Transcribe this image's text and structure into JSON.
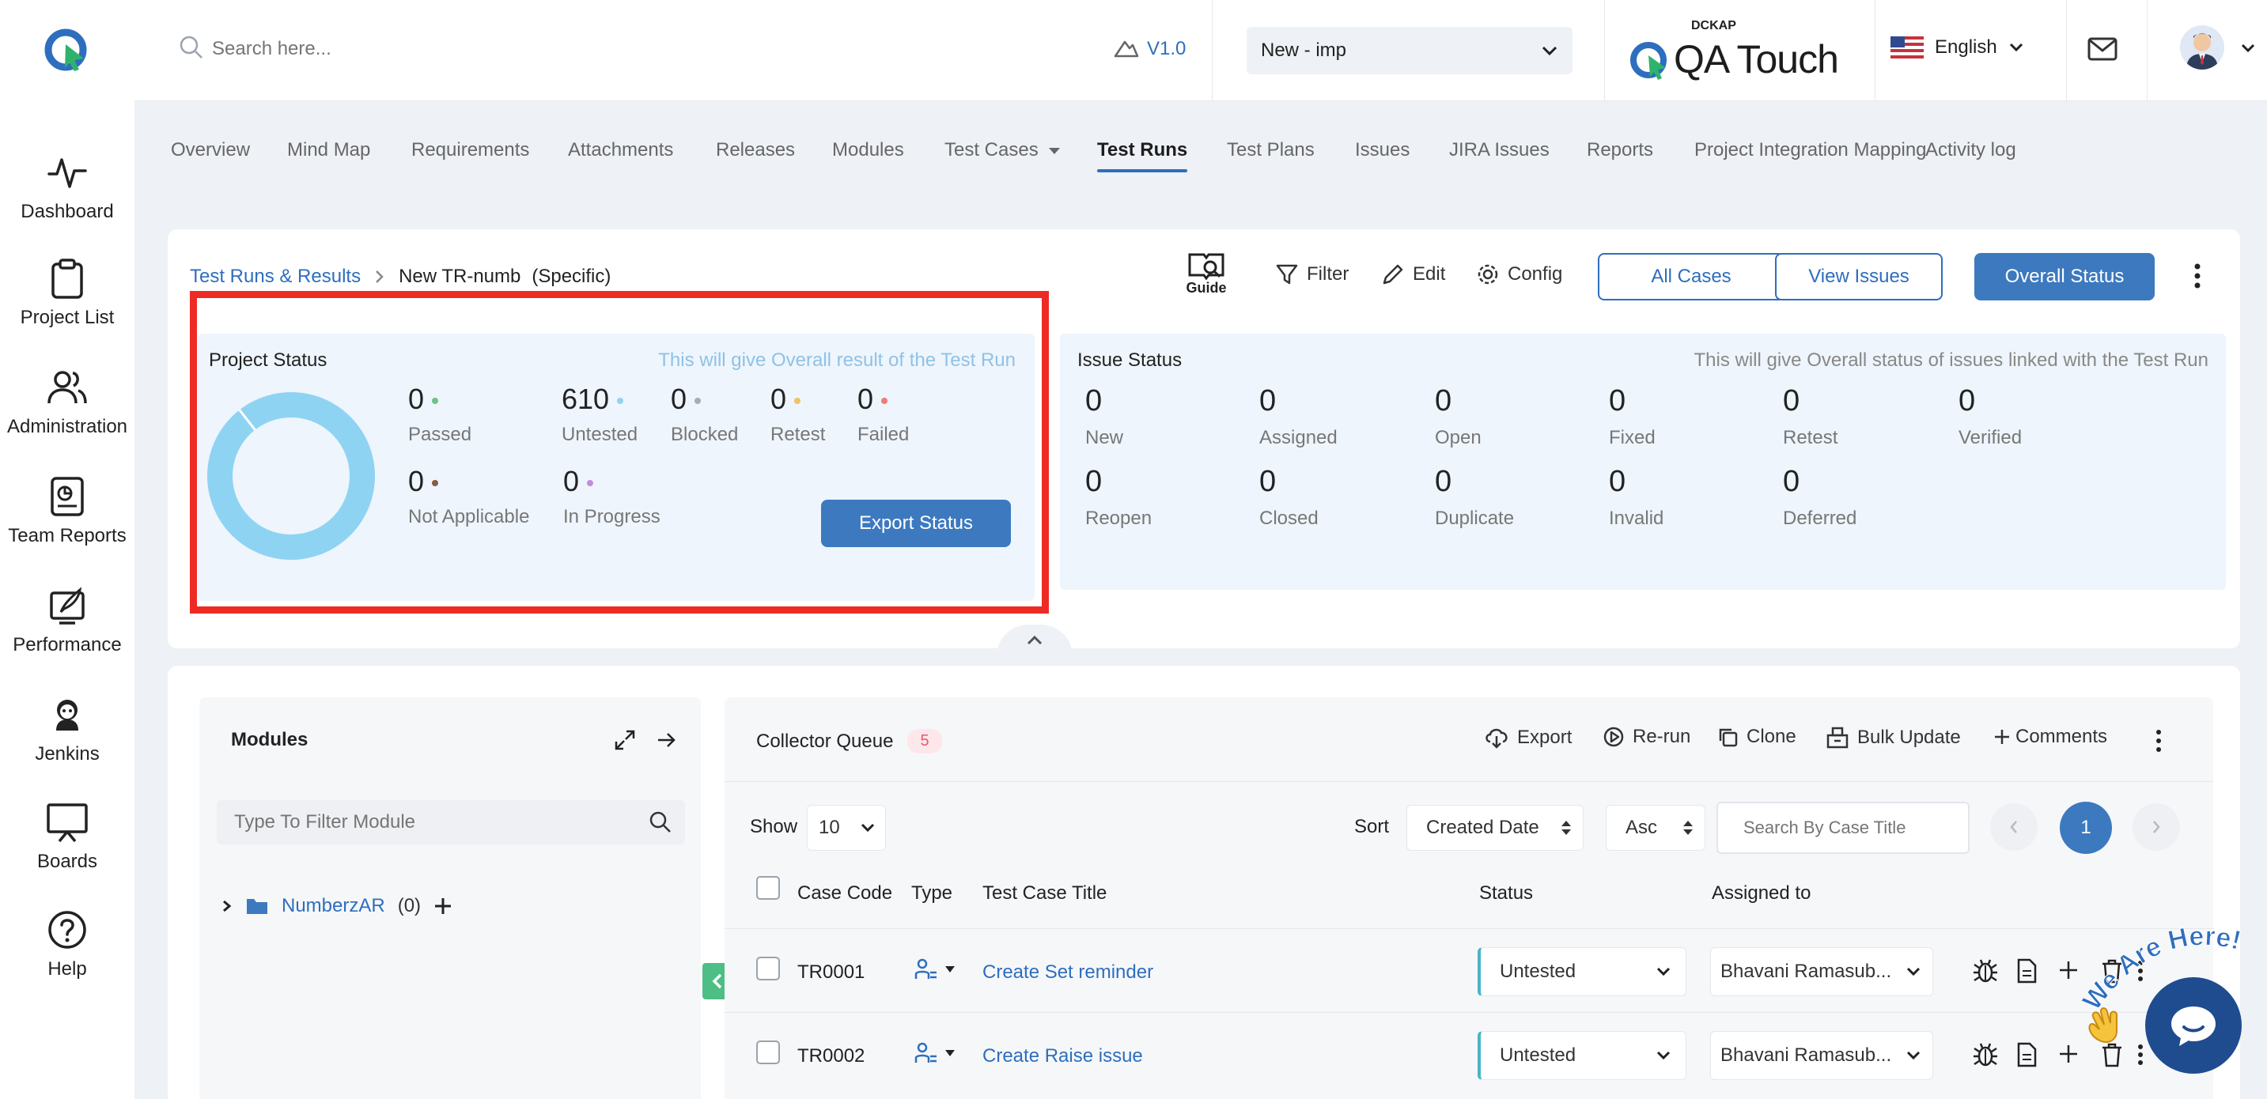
{
  "sidebar": {
    "items": [
      {
        "label": "Dashboard",
        "icon": "pulse-icon"
      },
      {
        "label": "Project List",
        "icon": "clipboard-icon"
      },
      {
        "label": "Administration",
        "icon": "users-icon"
      },
      {
        "label": "Team Reports",
        "icon": "report-icon"
      },
      {
        "label": "Performance",
        "icon": "rocket-icon"
      },
      {
        "label": "Jenkins",
        "icon": "jenkins-icon"
      },
      {
        "label": "Boards",
        "icon": "presentation-board-icon"
      },
      {
        "label": "Help",
        "icon": "question-circle-icon"
      }
    ]
  },
  "topbar": {
    "search_placeholder": "Search here...",
    "version": "V1.0",
    "project_select": "New - imp",
    "brand_small": "DCKAP",
    "brand_large": "QA Touch",
    "language": "English"
  },
  "tabs": [
    "Overview",
    "Mind Map",
    "Requirements",
    "Attachments",
    "Releases",
    "Modules",
    "Test Cases",
    "Test Runs",
    "Test Plans",
    "Issues",
    "JIRA Issues",
    "Reports",
    "Project Integration Mapping",
    "Activity log"
  ],
  "active_tab": "Test Runs",
  "breadcrumb": {
    "parent": "Test Runs & Results",
    "current": "New TR-numb",
    "qualifier": "(Specific)"
  },
  "toolbar": {
    "guide": "Guide",
    "filter": "Filter",
    "edit": "Edit",
    "config": "Config",
    "all_cases": "All Cases",
    "view_issues": "View Issues",
    "overall_status": "Overall Status"
  },
  "project_status": {
    "title": "Project Status",
    "hint": "This will give Overall result of the Test Run",
    "stats": [
      {
        "value": "0",
        "label": "Passed",
        "color": "#6cc28a"
      },
      {
        "value": "610",
        "label": "Untested",
        "color": "#8fd3f2"
      },
      {
        "value": "0",
        "label": "Blocked",
        "color": "#a7adb5"
      },
      {
        "value": "0",
        "label": "Retest",
        "color": "#f3c06a"
      },
      {
        "value": "0",
        "label": "Failed",
        "color": "#ef7b7b"
      },
      {
        "value": "0",
        "label": "Not Applicable",
        "color": "#8a5a44"
      },
      {
        "value": "0",
        "label": "In Progress",
        "color": "#c58be0"
      }
    ],
    "export_button": "Export Status"
  },
  "issue_status": {
    "title": "Issue Status",
    "hint": "This will give Overall status of issues linked with the Test Run",
    "items": [
      {
        "value": "0",
        "label": "New"
      },
      {
        "value": "0",
        "label": "Assigned"
      },
      {
        "value": "0",
        "label": "Open"
      },
      {
        "value": "0",
        "label": "Fixed"
      },
      {
        "value": "0",
        "label": "Retest"
      },
      {
        "value": "0",
        "label": "Verified"
      },
      {
        "value": "0",
        "label": "Reopen"
      },
      {
        "value": "0",
        "label": "Closed"
      },
      {
        "value": "0",
        "label": "Duplicate"
      },
      {
        "value": "0",
        "label": "Invalid"
      },
      {
        "value": "0",
        "label": "Deferred"
      }
    ]
  },
  "modules": {
    "title": "Modules",
    "filter_placeholder": "Type To Filter Module",
    "tree": [
      {
        "name": "NumberzAR",
        "count": "(0)"
      }
    ]
  },
  "collector": {
    "title": "Collector Queue",
    "count": "5",
    "actions": {
      "export": "Export",
      "rerun": "Re-run",
      "clone": "Clone",
      "bulk_update": "Bulk Update",
      "comments": "Comments"
    },
    "show_label": "Show",
    "show_value": "10",
    "sort_label": "Sort",
    "sort_field": "Created Date",
    "sort_order": "Asc",
    "search_placeholder": "Search By Case Title",
    "page": "1",
    "columns": {
      "code": "Case Code",
      "type": "Type",
      "title": "Test Case Title",
      "status": "Status",
      "assigned": "Assigned to"
    },
    "rows": [
      {
        "code": "TR0001",
        "title": "Create Set reminder",
        "status": "Untested",
        "assigned": "Bhavani Ramasub..."
      },
      {
        "code": "TR0002",
        "title": "Create Raise issue",
        "status": "Untested",
        "assigned": "Bhavani Ramasub..."
      }
    ]
  },
  "chat_badge": "We Are Here!",
  "colors": {
    "primary": "#2e6ebe",
    "highlight": "#ee2a24",
    "untested": "#8fd3f2"
  }
}
